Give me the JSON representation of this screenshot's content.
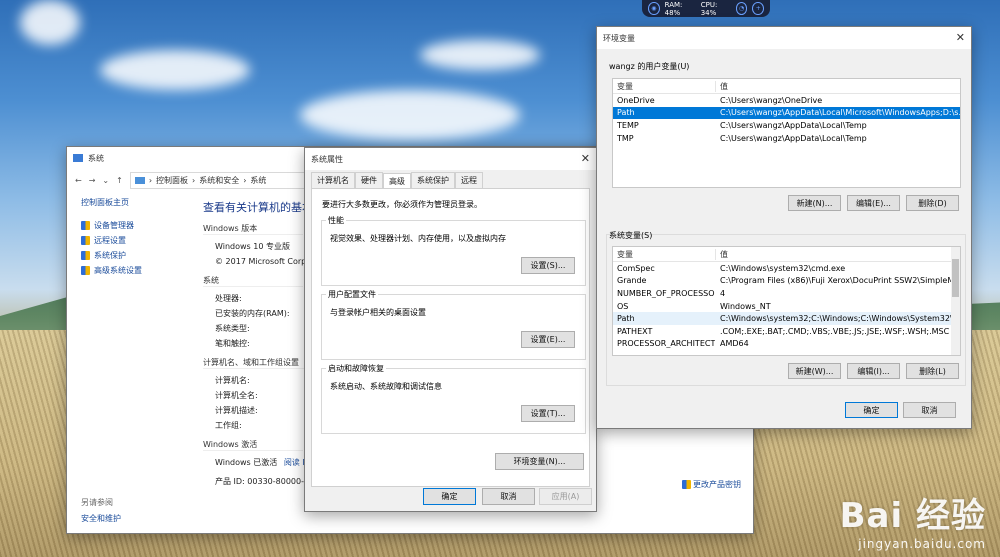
{
  "widget": {
    "ram": "RAM: 48%",
    "cpu": "CPU: 34%"
  },
  "system": {
    "title": "系统",
    "breadcrumb": [
      "控制面板",
      "系统和安全",
      "系统"
    ],
    "home": "控制面板主页",
    "links": [
      "设备管理器",
      "远程设置",
      "系统保护",
      "高级系统设置"
    ],
    "see_also": "另请参阅",
    "security": "安全和维护",
    "heading": "查看有关计算机的基本信",
    "edition_header": "Windows 版本",
    "edition": "Windows 10 专业版",
    "copyright": "© 2017 Microsoft Corpo",
    "system_header": "系统",
    "system_items": [
      "处理器:",
      "已安装的内存(RAM):",
      "系统类型:",
      "笔和触控:"
    ],
    "computer_header": "计算机名、域和工作组设置",
    "computer_items": [
      "计算机名:",
      "计算机全名:",
      "计算机描述:",
      "工作组:"
    ],
    "activation_header": "Windows 激活",
    "activated": "Windows 已激活",
    "read_link": "阅读 Mi",
    "product_id": "产品 ID: 00330-80000-000",
    "change_key": "更改产品密钥"
  },
  "props": {
    "title": "系统属性",
    "tabs": [
      "计算机名",
      "硬件",
      "高级",
      "系统保护",
      "远程"
    ],
    "note": "要进行大多数更改，你必须作为管理员登录。",
    "perf_title": "性能",
    "perf_desc": "视觉效果、处理器计划、内存使用，以及虚拟内存",
    "profile_title": "用户配置文件",
    "profile_desc": "与登录帐户相关的桌面设置",
    "startup_title": "启动和故障恢复",
    "startup_desc": "系统启动、系统故障和调试信息",
    "settings1": "设置(S)...",
    "settings2": "设置(E)...",
    "settings3": "设置(T)...",
    "env_button": "环境变量(N)...",
    "ok": "确定",
    "cancel": "取消",
    "apply": "应用(A)"
  },
  "env": {
    "title": "环境变量",
    "user_label": "wangz 的用户变量(U)",
    "col_var": "变量",
    "col_val": "值",
    "user_vars": [
      {
        "name": "OneDrive",
        "value": "C:\\Users\\wangz\\OneDrive"
      },
      {
        "name": "Path",
        "value": "C:\\Users\\wangz\\AppData\\Local\\Microsoft\\WindowsApps;D:\\s..."
      },
      {
        "name": "TEMP",
        "value": "C:\\Users\\wangz\\AppData\\Local\\Temp"
      },
      {
        "name": "TMP",
        "value": "C:\\Users\\wangz\\AppData\\Local\\Temp"
      }
    ],
    "user_new": "新建(N)...",
    "user_edit": "编辑(E)...",
    "user_delete": "删除(D)",
    "sys_label": "系统变量(S)",
    "sys_vars": [
      {
        "name": "ComSpec",
        "value": "C:\\Windows\\system32\\cmd.exe"
      },
      {
        "name": "Grande",
        "value": "C:\\Program Files (x86)\\Fuji Xerox\\DocuPrint SSW2\\SimpleMo..."
      },
      {
        "name": "NUMBER_OF_PROCESSORS",
        "value": "4"
      },
      {
        "name": "OS",
        "value": "Windows_NT"
      },
      {
        "name": "Path",
        "value": "C:\\Windows\\system32;C:\\Windows;C:\\Windows\\System32\\Wb..."
      },
      {
        "name": "PATHEXT",
        "value": ".COM;.EXE;.BAT;.CMD;.VBS;.VBE;.JS;.JSE;.WSF;.WSH;.MSC"
      },
      {
        "name": "PROCESSOR_ARCHITECT...",
        "value": "AMD64"
      }
    ],
    "sys_new": "新建(W)...",
    "sys_edit": "编辑(I)...",
    "sys_delete": "删除(L)",
    "ok": "确定",
    "cancel": "取消"
  },
  "watermark": {
    "logo": "Bai 经验",
    "url": "jingyan.baidu.com"
  }
}
